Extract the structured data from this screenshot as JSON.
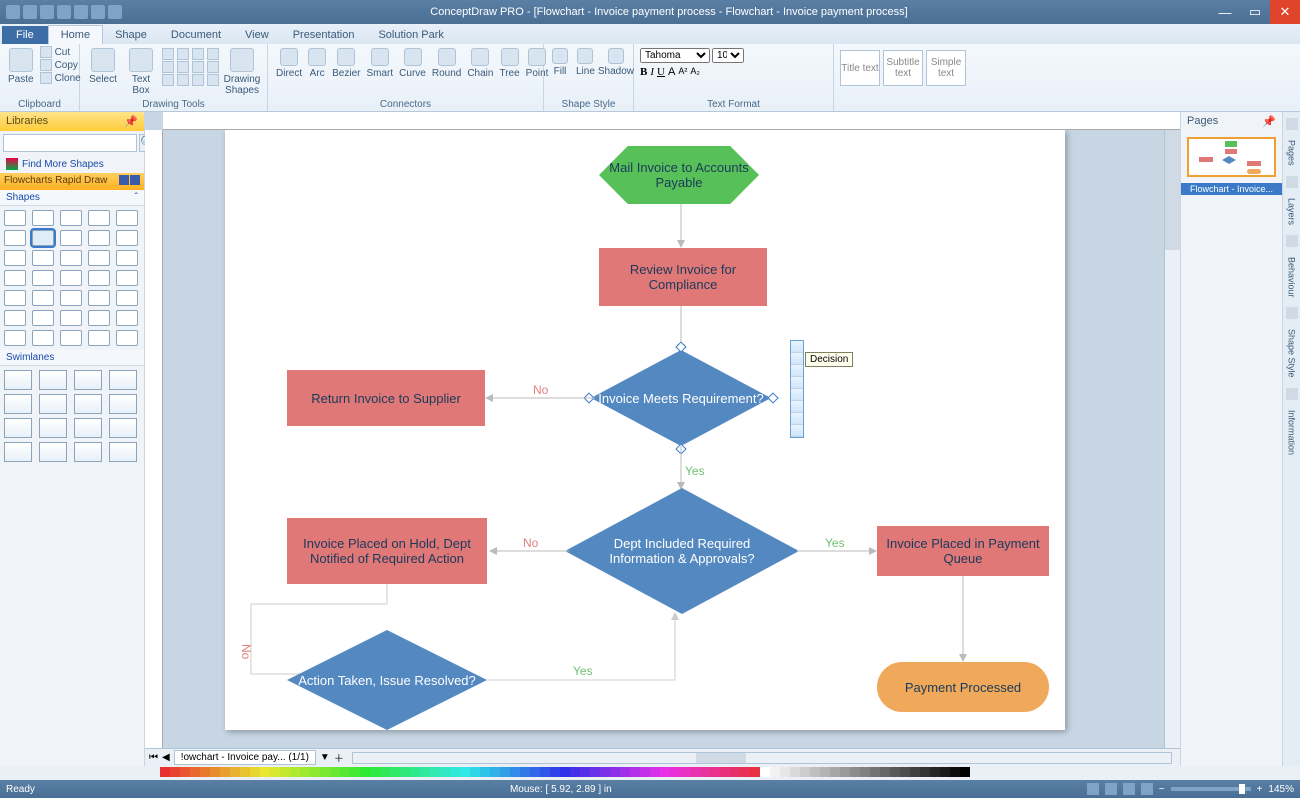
{
  "app": {
    "title": "ConceptDraw PRO - [Flowchart - Invoice payment process - Flowchart - Invoice payment process]",
    "ready": "Ready"
  },
  "tabs": {
    "file": "File",
    "items": [
      "Home",
      "Shape",
      "Document",
      "View",
      "Presentation",
      "Solution Park"
    ],
    "active": 0
  },
  "ribbon": {
    "clipboard": {
      "label": "Clipboard",
      "paste": "Paste",
      "cut": "Cut",
      "copy": "Copy",
      "clone": "Clone"
    },
    "drawing": {
      "label": "Drawing Tools",
      "select": "Select",
      "textbox": "Text\nBox",
      "shapes": "Drawing\nShapes"
    },
    "connectors": {
      "label": "Connectors",
      "items": [
        "Direct",
        "Arc",
        "Bezier",
        "Smart",
        "Curve",
        "Round",
        "Chain",
        "Tree",
        "Point"
      ]
    },
    "shapestyle": {
      "label": "Shape Style",
      "fill": "Fill",
      "line": "Line",
      "shadow": "Shadow"
    },
    "textformat": {
      "label": "Text Format",
      "font": "Tahoma",
      "size": "10"
    },
    "styles": [
      "Title text",
      "Subtitle text",
      "Simple text"
    ]
  },
  "left": {
    "hdr": "Libraries",
    "findmore": "Find More Shapes",
    "lib": "Flowcharts Rapid Draw",
    "shapes": "Shapes",
    "swim": "Swimlanes"
  },
  "flow": {
    "n1": "Mail Invoice to Accounts Payable",
    "n2": "Review Invoice for Compliance",
    "n3": "Invoice Meets Requirement?",
    "n4": "Return Invoice to Supplier",
    "n5": "Dept Included Required Information & Approvals?",
    "n6": "Invoice Placed on Hold, Dept Notified of Required Action",
    "n7": "Invoice Placed in Payment Queue",
    "n8": "Action Taken, Issue Resolved?",
    "n9": "Payment Processed",
    "yes": "Yes",
    "no": "No",
    "tooltip": "Decision"
  },
  "right": {
    "hdr": "Pages",
    "thumb": "Flowchart - Invoice...",
    "tabs": [
      "Pages",
      "Layers",
      "Behaviour",
      "Shape Style",
      "Information"
    ]
  },
  "status": {
    "mouse": "Mouse: [ 5.92, 2.89 ] in",
    "zoom": "145%"
  },
  "pagetab": "!owchart - Invoice pay...  (1/1)"
}
